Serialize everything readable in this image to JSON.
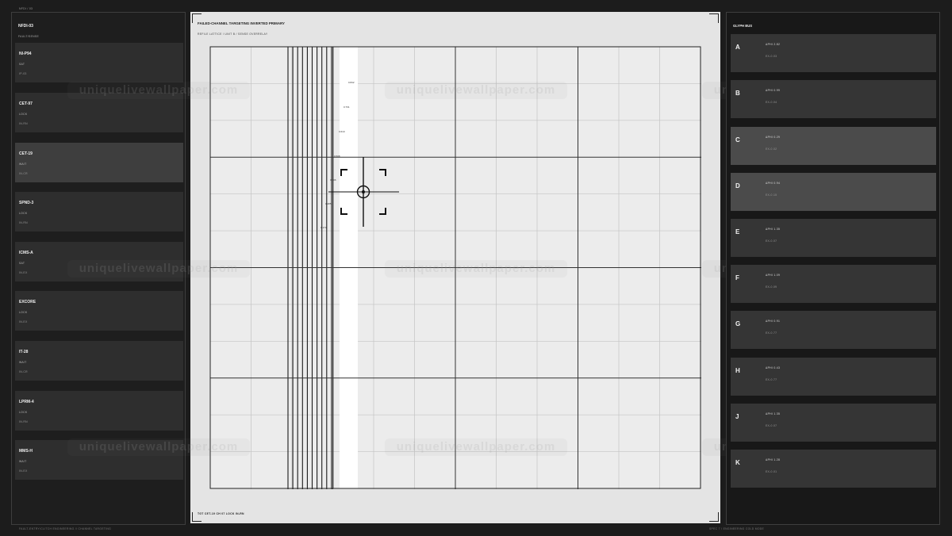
{
  "top_tag": "NFDI / 03",
  "footer": {
    "left": "FAULT-ENTRY/CLITCH ENGINEERING // CHANNEL TARGETING",
    "right": "SPEC 7 / ENGINEERING COLD MODE"
  },
  "left_panel": {
    "title": "NFDI-03",
    "subtitle": "FAULT/SENSE",
    "channels": [
      {
        "name": "NI-P94",
        "state": "SAT",
        "code": "IP-03",
        "selected": false
      },
      {
        "name": "CET-97",
        "state": "LOCK",
        "code": "IN-RN",
        "selected": false
      },
      {
        "name": "CET-19",
        "state": "WAIT",
        "code": "IN-CR",
        "selected": true
      },
      {
        "name": "SPND-3",
        "state": "LOCK",
        "code": "IN-RN",
        "selected": false
      },
      {
        "name": "ICMS-A",
        "state": "SAT",
        "code": "IN-EX",
        "selected": false
      },
      {
        "name": "EXCORE",
        "state": "LOCK",
        "code": "IN-EX",
        "selected": false
      },
      {
        "name": "IT-28",
        "state": "WAIT",
        "code": "IN-CR",
        "selected": false
      },
      {
        "name": "LPRM-4",
        "state": "LOCK",
        "code": "IN-RN",
        "selected": false
      },
      {
        "name": "MMS-H",
        "state": "WAIT",
        "code": "IN-EX",
        "selected": false
      }
    ]
  },
  "center": {
    "title": "FAILED-CHANNEL TARGETING  INVERTED PRIMARY",
    "subtitle": "REFILE LATTICE / UNIT B / SENSE OVERRELAY",
    "footer": "TGT CET-19  CH 07  LOCK IN-RN",
    "tick_labels": [
      "0.842",
      "0.731",
      "0.619",
      "0.508",
      "0.396",
      "0.285",
      "0.174"
    ]
  },
  "watermark": "uniquelivewallpaper.com",
  "right_panel": {
    "title": "GLYPH BUS",
    "glyphs": [
      {
        "letter": "A",
        "value": "ΔPHI 2.82",
        "code": "EX-0.03",
        "highlight": false
      },
      {
        "letter": "B",
        "value": "ΔPHI 0.99",
        "code": "EX-0.04",
        "highlight": false
      },
      {
        "letter": "C",
        "value": "ΔPHI 0.29",
        "code": "EX-0.02",
        "highlight": true
      },
      {
        "letter": "D",
        "value": "ΔPHI 0.94",
        "code": "EX-0.15",
        "highlight": true
      },
      {
        "letter": "E",
        "value": "ΔPHI 1.35",
        "code": "EX-0.07",
        "highlight": false
      },
      {
        "letter": "F",
        "value": "ΔPHI 1.09",
        "code": "EX-0.09",
        "highlight": false
      },
      {
        "letter": "G",
        "value": "ΔPHI 0.91",
        "code": "EX-0.77",
        "highlight": false
      },
      {
        "letter": "H",
        "value": "ΔPHI 0.43",
        "code": "EX-0.77",
        "highlight": false
      },
      {
        "letter": "J",
        "value": "ΔPHI 1.35",
        "code": "EX-0.07",
        "highlight": false
      },
      {
        "letter": "K",
        "value": "ΔPHI 1.28",
        "code": "EX-0.01",
        "highlight": false
      }
    ]
  }
}
